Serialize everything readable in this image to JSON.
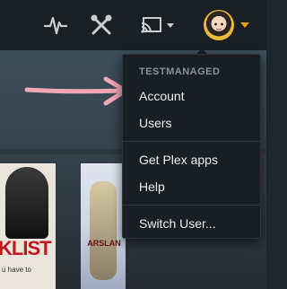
{
  "menu": {
    "header": "TESTMANAGED",
    "items": [
      "Account",
      "Users",
      "Get Plex apps",
      "Help",
      "Switch User..."
    ]
  },
  "posters": {
    "poster1_title": "KLIST",
    "poster1_sub": "u have to",
    "poster2_title": "ARSLAN"
  },
  "icons": {
    "activity": "activity-icon",
    "settings": "settings-icon",
    "cast": "cast-icon",
    "user": "avatar",
    "user_caret": "chevron-down-icon"
  },
  "colors": {
    "accent": "#e5a00d",
    "annotation_arrow": "#f2a6b6",
    "menu_bg": "#191e22"
  }
}
